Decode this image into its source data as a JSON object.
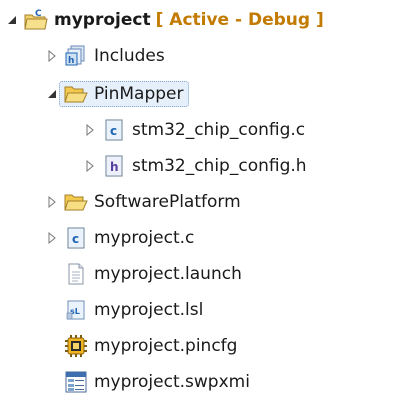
{
  "project": {
    "name": "myproject",
    "status": "[ Active - Debug ]"
  },
  "items": [
    {
      "label": "Includes"
    },
    {
      "label": "PinMapper"
    },
    {
      "label": "stm32_chip_config.c"
    },
    {
      "label": "stm32_chip_config.h"
    },
    {
      "label": "SoftwarePlatform"
    },
    {
      "label": "myproject.c"
    },
    {
      "label": "myproject.launch"
    },
    {
      "label": "myproject.lsl"
    },
    {
      "label": "myproject.pincfg"
    },
    {
      "label": "myproject.swpxmi"
    }
  ],
  "colors": {
    "folder": "#f2c94c",
    "c_icon": "#1f64b4",
    "h_icon": "#5a3fa0",
    "accent_status": "#c27a00"
  },
  "icons": {
    "project": "project-folder-icon",
    "includes": "includes-icon",
    "folder": "folder-icon",
    "c_file": "c-file-icon",
    "h_file": "h-file-icon",
    "launch": "launch-file-icon",
    "lsl": "linker-script-icon",
    "pincfg": "pin-config-icon",
    "swpxmi": "software-platform-icon"
  }
}
